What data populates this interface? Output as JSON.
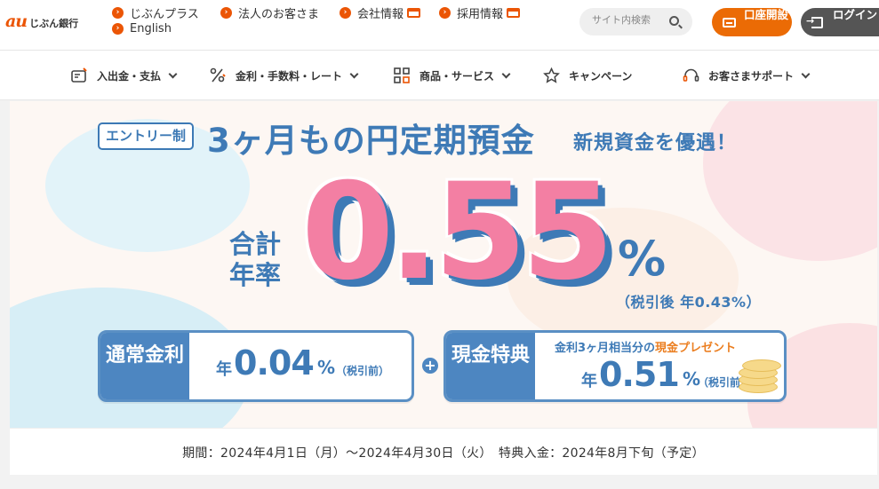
{
  "header": {
    "logo_mark": "au",
    "logo_text": "じぶん銀行",
    "links": [
      {
        "label": "じぶんプラス",
        "external": false
      },
      {
        "label": "法人のお客さま",
        "external": false
      },
      {
        "label": "会社情報",
        "external": true
      },
      {
        "label": "採用情報",
        "external": true
      },
      {
        "label": "English",
        "external": false
      }
    ],
    "search_placeholder": "サイト内検索",
    "open_account_label": "口座開設",
    "login_label": "ログイン",
    "accent_color": "#eb5505"
  },
  "nav": {
    "items": [
      {
        "label": "入出金・支払",
        "icon": "wallet-icon"
      },
      {
        "label": "金利・手数料・レート",
        "icon": "percent-icon"
      },
      {
        "label": "商品・サービス",
        "icon": "grid-icon"
      },
      {
        "label": "キャンペーン",
        "icon": "star-icon"
      },
      {
        "label": "お客さまサポート",
        "icon": "headset-icon"
      }
    ]
  },
  "banner": {
    "entry_badge": "エントリー制",
    "headline": "3ヶ月もの円定期預金",
    "subhead": "新規資金を優遇！",
    "rate_label": "合計年率",
    "rate_value": "0.55",
    "rate_unit": "%",
    "after_tax": "（税引後 年0.43%）",
    "normal": {
      "label": "通常金利",
      "prefix": "年",
      "value": "0.04",
      "unit": "%",
      "note": "（税引前）"
    },
    "bonus": {
      "label": "現金特典",
      "present_prefix": "金利3ヶ月相当分の",
      "present_highlight": "現金プレゼント",
      "prefix": "年",
      "value": "0.51",
      "unit": "%",
      "note": "（税引前）"
    },
    "brand_blue": "#3e7ab6",
    "brand_pink": "#f37fa3"
  },
  "period_text": "期間：2024年4月1日（月）～2024年4月30日（火）　特典入金：2024年8月下旬（予定）"
}
